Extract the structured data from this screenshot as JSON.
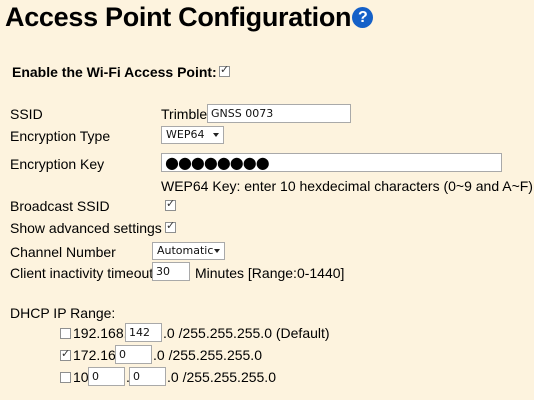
{
  "page": {
    "title": "Access Point Configuration",
    "help_icon": "?"
  },
  "enable_ap": {
    "label": "Enable the Wi-Fi Access Point:",
    "checked": true
  },
  "ssid": {
    "label": "SSID",
    "prefix": "Trimble",
    "value": "GNSS 0073"
  },
  "encryption_type": {
    "label": "Encryption Type",
    "value": "WEP64"
  },
  "encryption_key": {
    "label": "Encryption Key",
    "masked_value": "●●●●●●●●",
    "hint": "WEP64 Key: enter 10 hexdecimal characters (0~9 and A~F)"
  },
  "broadcast_ssid": {
    "label": "Broadcast SSID",
    "checked": true
  },
  "show_advanced": {
    "label": "Show advanced settings",
    "checked": true
  },
  "channel": {
    "label": "Channel Number",
    "value": "Automatic"
  },
  "inactivity": {
    "label": "Client inactivity timeout",
    "value": "30",
    "suffix": "Minutes [Range:0-1440]"
  },
  "dhcp": {
    "label": "DHCP IP Range:",
    "options": [
      {
        "checked": false,
        "prefix": "192.168.",
        "octet3": "142",
        "suffix": ".0 /255.255.255.0  (Default)"
      },
      {
        "checked": true,
        "prefix": "172.16.",
        "octet3": "0",
        "suffix": ".0 /255.255.255.0"
      },
      {
        "checked": false,
        "prefix": "10.",
        "octet2": "0",
        "octet3": "0",
        "suffix": ".0 /255.255.255.0"
      }
    ]
  }
}
